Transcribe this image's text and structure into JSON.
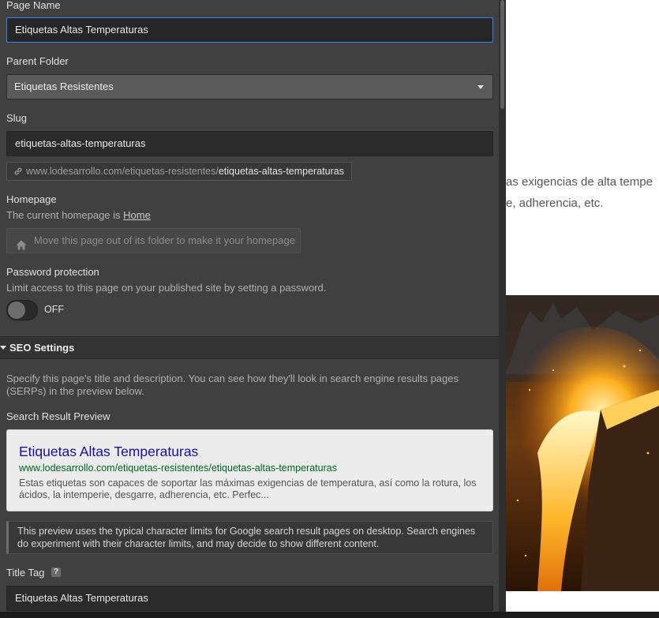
{
  "page_settings": {
    "page_name": {
      "label": "Page Name",
      "value": "Etiquetas Altas Temperaturas"
    },
    "parent_folder": {
      "label": "Parent Folder",
      "value": "Etiquetas Resistentes"
    },
    "slug": {
      "label": "Slug",
      "value": "etiquetas-altas-temperaturas",
      "url_base": "www.lodesarrollo.com/etiquetas-resistentes/",
      "url_slug": "etiquetas-altas-temperaturas"
    },
    "homepage": {
      "label": "Homepage",
      "text": "The current homepage is",
      "link": "Home",
      "button_label": "Move this page out of its folder to make it your homepage"
    },
    "password": {
      "label": "Password protection",
      "description": "Limit access to this page on your published site by setting a password.",
      "toggle_label": "OFF"
    }
  },
  "seo": {
    "header": "SEO Settings",
    "description": "Specify this page's title and description. You can see how they'll look in search engine results pages (SERPs) in the preview below.",
    "preview_label": "Search Result Preview",
    "preview": {
      "title": "Etiquetas Altas Temperaturas",
      "url": "www.lodesarrollo.com/etiquetas-resistentes/etiquetas-altas-temperaturas",
      "description": "Estas etiquetas son capaces de soportar las máximas exigencias de temperatura, así como la rotura, los ácidos, la intemperie, desgarre, adherencia, etc. Perfec..."
    },
    "notice": "This preview uses the typical character limits for Google search result pages on desktop. Search engines do experiment with their character limits, and may decide to show different content.",
    "title_tag": {
      "label": "Title Tag",
      "help": "?",
      "value": "Etiquetas Altas Temperaturas"
    }
  },
  "canvas": {
    "line1": "as exigencias de alta tempe",
    "line2": "e, adherencia, etc."
  },
  "icons": {
    "link": "link-icon",
    "home": "home-icon",
    "caret": "chevron-down-icon",
    "disclosure": "triangle-down-icon"
  },
  "colors": {
    "panel_bg": "#404040",
    "focus_accent": "#3b82f6",
    "serp_title": "#1a0dab",
    "serp_url": "#006621"
  }
}
